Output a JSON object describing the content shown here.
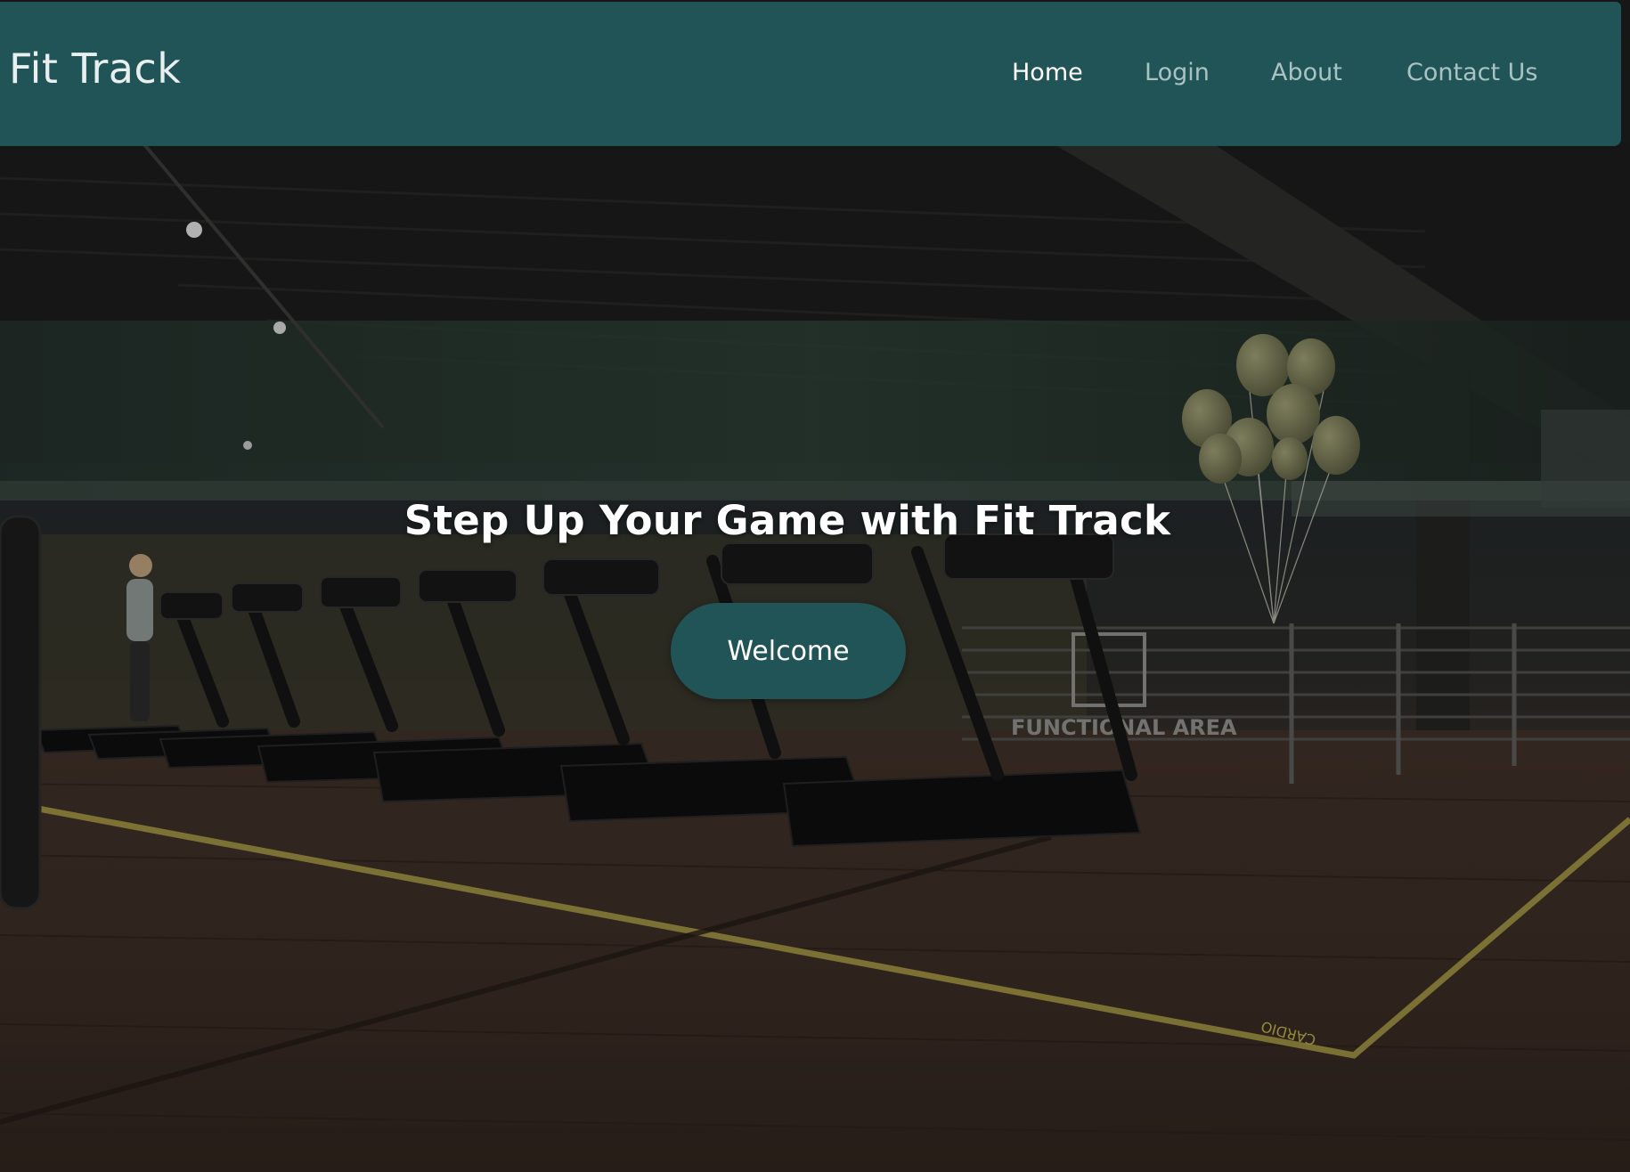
{
  "navbar": {
    "brand": "Fit Track",
    "links": [
      {
        "label": "Home",
        "active": true
      },
      {
        "label": "Login",
        "active": false
      },
      {
        "label": "About",
        "active": false
      },
      {
        "label": "Contact Us",
        "active": false
      }
    ]
  },
  "hero": {
    "title": "Step Up Your Game with Fit Track",
    "cta_label": "Welcome",
    "background_scene": "dark gym interior with treadmills",
    "signage": {
      "area_sign": "FUNCTIONAL AREA",
      "floor_marking": "CARDIO"
    }
  },
  "colors": {
    "navbar_bg": "#215457",
    "nav_active": "#ffffff",
    "nav_inactive": "#a9c3c2",
    "cta_bg": "#215457",
    "floor_line": "#b8a94a"
  }
}
